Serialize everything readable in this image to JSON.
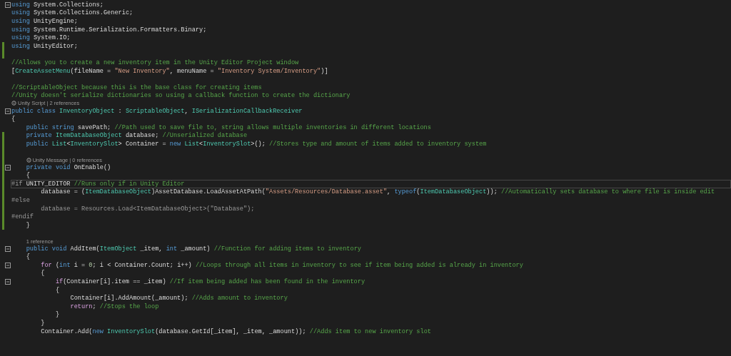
{
  "editor": {
    "lines": [
      {
        "kind": "code",
        "fold": true,
        "changed": false,
        "current": false,
        "tokens": [
          {
            "text": "using",
            "kind": "keyword"
          },
          {
            "text": " System.Collections;",
            "kind": "plain"
          }
        ]
      },
      {
        "kind": "code",
        "fold": false,
        "changed": false,
        "current": false,
        "tokens": [
          {
            "text": "using",
            "kind": "keyword"
          },
          {
            "text": " System.Collections.Generic;",
            "kind": "plain"
          }
        ]
      },
      {
        "kind": "code",
        "fold": false,
        "changed": false,
        "current": false,
        "tokens": [
          {
            "text": "using",
            "kind": "keyword"
          },
          {
            "text": " UnityEngine;",
            "kind": "plain"
          }
        ]
      },
      {
        "kind": "code",
        "fold": false,
        "changed": false,
        "current": false,
        "tokens": [
          {
            "text": "using",
            "kind": "keyword"
          },
          {
            "text": " System.Runtime.Serialization.Formatters.Binary;",
            "kind": "plain"
          }
        ]
      },
      {
        "kind": "code",
        "fold": false,
        "changed": false,
        "current": false,
        "tokens": [
          {
            "text": "using",
            "kind": "keyword"
          },
          {
            "text": " System.IO;",
            "kind": "plain"
          }
        ]
      },
      {
        "kind": "code",
        "fold": false,
        "changed": true,
        "current": false,
        "tokens": [
          {
            "text": "using",
            "kind": "keyword"
          },
          {
            "text": " UnityEditor;",
            "kind": "plain"
          }
        ]
      },
      {
        "kind": "blank",
        "changed": true
      },
      {
        "kind": "code",
        "fold": false,
        "changed": false,
        "current": false,
        "tokens": [
          {
            "text": "//Allows you to create a new inventory item in the Unity Editor Project window",
            "kind": "comment"
          }
        ]
      },
      {
        "kind": "code",
        "fold": false,
        "changed": false,
        "current": false,
        "tokens": [
          {
            "text": "[",
            "kind": "plain"
          },
          {
            "text": "CreateAssetMenu",
            "kind": "type"
          },
          {
            "text": "(fileName = ",
            "kind": "plain"
          },
          {
            "text": "\"New Inventory\"",
            "kind": "string"
          },
          {
            "text": ", menuName = ",
            "kind": "plain"
          },
          {
            "text": "\"Inventory System/Inventory\"",
            "kind": "string"
          },
          {
            "text": ")]",
            "kind": "plain"
          }
        ]
      },
      {
        "kind": "blank",
        "changed": false
      },
      {
        "kind": "code",
        "fold": false,
        "changed": false,
        "current": false,
        "tokens": [
          {
            "text": "//ScriptableObject because this is the base class for creating items",
            "kind": "comment"
          }
        ]
      },
      {
        "kind": "code",
        "fold": false,
        "changed": false,
        "current": false,
        "tokens": [
          {
            "text": "//Unity doesn't serialize dictionaries so using a callback function to create the dictionary",
            "kind": "comment"
          }
        ]
      },
      {
        "kind": "code",
        "fold": true,
        "changed": false,
        "current": false,
        "codelens": {
          "text": "Unity Script | 2 references",
          "unity": true
        },
        "tokens": [
          {
            "text": "public class",
            "kind": "keyword"
          },
          {
            "text": " InventoryObject",
            "kind": "type"
          },
          {
            "text": " : ",
            "kind": "plain"
          },
          {
            "text": "ScriptableObject",
            "kind": "type"
          },
          {
            "text": ", ",
            "kind": "plain"
          },
          {
            "text": "ISerializationCallbackReceiver",
            "kind": "type"
          }
        ]
      },
      {
        "kind": "code",
        "fold": false,
        "changed": false,
        "current": false,
        "tokens": [
          {
            "text": "{",
            "kind": "plain"
          }
        ]
      },
      {
        "kind": "code",
        "fold": false,
        "changed": false,
        "current": false,
        "tokens": [
          {
            "text": "    public string",
            "kind": "keyword"
          },
          {
            "text": " savePath; ",
            "kind": "plain"
          },
          {
            "text": "//Path used to save file to, string allows multiple inventories in different locations",
            "kind": "comment"
          }
        ]
      },
      {
        "kind": "code",
        "fold": false,
        "changed": true,
        "current": false,
        "tokens": [
          {
            "text": "    private",
            "kind": "keyword"
          },
          {
            "text": " ItemDatabaseObject",
            "kind": "type"
          },
          {
            "text": " database; ",
            "kind": "plain"
          },
          {
            "text": "//Unserialized database",
            "kind": "comment"
          }
        ]
      },
      {
        "kind": "code",
        "fold": false,
        "changed": true,
        "current": false,
        "tokens": [
          {
            "text": "    public",
            "kind": "keyword"
          },
          {
            "text": " List",
            "kind": "type"
          },
          {
            "text": "<",
            "kind": "plain"
          },
          {
            "text": "InventorySlot",
            "kind": "type"
          },
          {
            "text": "> Container = ",
            "kind": "plain"
          },
          {
            "text": "new",
            "kind": "keyword"
          },
          {
            "text": " List",
            "kind": "type"
          },
          {
            "text": "<",
            "kind": "plain"
          },
          {
            "text": "InventorySlot",
            "kind": "type"
          },
          {
            "text": ">(); ",
            "kind": "plain"
          },
          {
            "text": "//Stores type and amount of items added to inventory system",
            "kind": "comment"
          }
        ]
      },
      {
        "kind": "blank",
        "changed": true
      },
      {
        "kind": "code",
        "fold": true,
        "changed": true,
        "current": false,
        "codelens": {
          "text": "Unity Message | 0 references",
          "unity": true
        },
        "tokens": [
          {
            "text": "    private void",
            "kind": "keyword"
          },
          {
            "text": " OnEnable()",
            "kind": "plain"
          }
        ]
      },
      {
        "kind": "code",
        "fold": false,
        "changed": true,
        "current": false,
        "tokens": [
          {
            "text": "    {",
            "kind": "plain"
          }
        ]
      },
      {
        "kind": "code",
        "fold": false,
        "changed": true,
        "current": true,
        "tokens": [
          {
            "text": "#if",
            "kind": "preprocessor"
          },
          {
            "text": " UNITY_EDITOR ",
            "kind": "plain"
          },
          {
            "text": "//Runs only if in Unity Editor",
            "kind": "comment"
          }
        ]
      },
      {
        "kind": "code",
        "fold": false,
        "changed": true,
        "current": false,
        "tokens": [
          {
            "text": "        database = (",
            "kind": "plain"
          },
          {
            "text": "ItemDatabaseObject",
            "kind": "type"
          },
          {
            "text": ")AssetDatabase.LoadAssetAtPath(",
            "kind": "plain"
          },
          {
            "text": "\"Assets/Resources/Database.asset\"",
            "kind": "string"
          },
          {
            "text": ", ",
            "kind": "plain"
          },
          {
            "text": "typeof",
            "kind": "keyword"
          },
          {
            "text": "(",
            "kind": "plain"
          },
          {
            "text": "ItemDatabaseObject",
            "kind": "type"
          },
          {
            "text": ")); ",
            "kind": "plain"
          },
          {
            "text": "//Automatically sets database to where file is inside edit",
            "kind": "comment"
          }
        ]
      },
      {
        "kind": "code",
        "fold": false,
        "changed": true,
        "current": false,
        "tokens": [
          {
            "text": "#else",
            "kind": "preprocessor"
          }
        ]
      },
      {
        "kind": "code",
        "fold": false,
        "changed": true,
        "current": false,
        "tokens": [
          {
            "text": "        database = Resources.Load<ItemDatabaseObject>(\"Database\");",
            "kind": "dim"
          }
        ]
      },
      {
        "kind": "code",
        "fold": false,
        "changed": true,
        "current": false,
        "tokens": [
          {
            "text": "#endif",
            "kind": "preprocessor"
          }
        ]
      },
      {
        "kind": "code",
        "fold": false,
        "changed": true,
        "current": false,
        "tokens": [
          {
            "text": "    }",
            "kind": "plain"
          }
        ]
      },
      {
        "kind": "blank",
        "changed": false
      },
      {
        "kind": "code",
        "fold": true,
        "changed": false,
        "current": false,
        "codelens": {
          "text": "1 reference",
          "unity": false
        },
        "tokens": [
          {
            "text": "    public void",
            "kind": "keyword"
          },
          {
            "text": " AddItem(",
            "kind": "plain"
          },
          {
            "text": "ItemObject",
            "kind": "type"
          },
          {
            "text": " _item, ",
            "kind": "plain"
          },
          {
            "text": "int",
            "kind": "keyword"
          },
          {
            "text": " _amount) ",
            "kind": "plain"
          },
          {
            "text": "//Function for adding items to inventory",
            "kind": "comment"
          }
        ]
      },
      {
        "kind": "code",
        "fold": false,
        "changed": false,
        "current": false,
        "tokens": [
          {
            "text": "    {",
            "kind": "plain"
          }
        ]
      },
      {
        "kind": "code",
        "fold": true,
        "changed": false,
        "current": false,
        "tokens": [
          {
            "text": "        for",
            "kind": "control"
          },
          {
            "text": " (",
            "kind": "plain"
          },
          {
            "text": "int",
            "kind": "keyword"
          },
          {
            "text": " i = ",
            "kind": "plain"
          },
          {
            "text": "0",
            "kind": "number"
          },
          {
            "text": "; i < Container.Count; i++) ",
            "kind": "plain"
          },
          {
            "text": "//Loops through all items in inventory to see if item being added is already in inventory",
            "kind": "comment"
          }
        ]
      },
      {
        "kind": "code",
        "fold": false,
        "changed": false,
        "current": false,
        "tokens": [
          {
            "text": "        {",
            "kind": "plain"
          }
        ]
      },
      {
        "kind": "code",
        "fold": true,
        "changed": false,
        "current": false,
        "tokens": [
          {
            "text": "            if",
            "kind": "control"
          },
          {
            "text": "(Container[i].item == _item) ",
            "kind": "plain"
          },
          {
            "text": "//If item being added has been found in the inventory",
            "kind": "comment"
          }
        ]
      },
      {
        "kind": "code",
        "fold": false,
        "changed": false,
        "current": false,
        "tokens": [
          {
            "text": "            {",
            "kind": "plain"
          }
        ]
      },
      {
        "kind": "code",
        "fold": false,
        "changed": false,
        "current": false,
        "tokens": [
          {
            "text": "                Container[i].AddAmount(_amount); ",
            "kind": "plain"
          },
          {
            "text": "//Adds amount to inventory",
            "kind": "comment"
          }
        ]
      },
      {
        "kind": "code",
        "fold": false,
        "changed": false,
        "current": false,
        "tokens": [
          {
            "text": "                return",
            "kind": "control"
          },
          {
            "text": "; ",
            "kind": "plain"
          },
          {
            "text": "//Stops the loop",
            "kind": "comment"
          }
        ]
      },
      {
        "kind": "code",
        "fold": false,
        "changed": false,
        "current": false,
        "tokens": [
          {
            "text": "            }",
            "kind": "plain"
          }
        ]
      },
      {
        "kind": "code",
        "fold": false,
        "changed": false,
        "current": false,
        "tokens": [
          {
            "text": "        }",
            "kind": "plain"
          }
        ]
      },
      {
        "kind": "code",
        "fold": false,
        "changed": false,
        "current": false,
        "tokens": [
          {
            "text": "        Container.Add(",
            "kind": "plain"
          },
          {
            "text": "new",
            "kind": "keyword"
          },
          {
            "text": " InventorySlot",
            "kind": "type"
          },
          {
            "text": "(database.GetId[_item], _item, _amount)); ",
            "kind": "plain"
          },
          {
            "text": "//Adds item to new inventory slot",
            "kind": "comment"
          }
        ]
      }
    ]
  }
}
